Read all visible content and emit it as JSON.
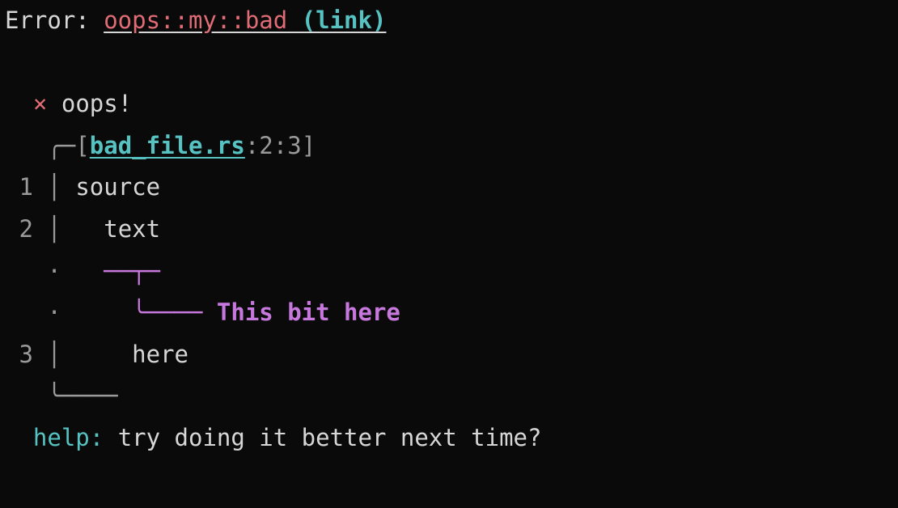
{
  "header": {
    "prefix": "Error: ",
    "code": "oops::my::bad",
    "link_open": " (",
    "link_text": "link",
    "link_close": ")"
  },
  "severity": {
    "icon": "×",
    "message": "oops!"
  },
  "source": {
    "bracket_open": "[",
    "filename": "bad_file.rs",
    "loc": ":2:3",
    "bracket_close": "]",
    "lineno_1": "1",
    "code_1": "source",
    "lineno_2": "2",
    "code_2": "  text",
    "annotation": "This bit here",
    "lineno_3": "3",
    "code_3": "    here",
    "box_top": "   ╭─",
    "box_pipe": " │ ",
    "box_dot": " · ",
    "underline": "  ──┬─",
    "pointer": "    ╰──── ",
    "box_bottom": "   ╰────"
  },
  "help": {
    "label": "help: ",
    "text": "try doing it better next time?"
  }
}
